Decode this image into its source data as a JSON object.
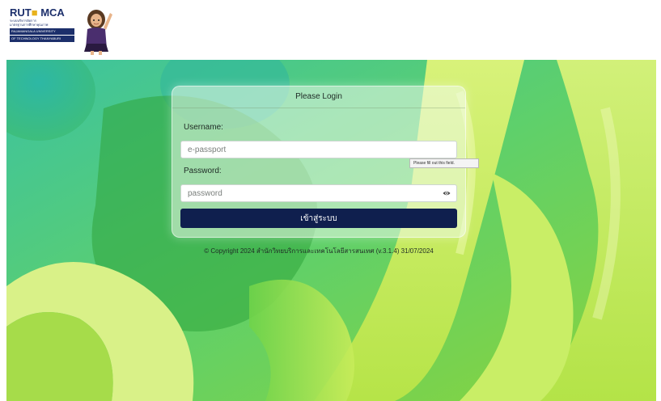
{
  "header": {
    "logo": {
      "title_part1": "RUT",
      "title_accent": "■",
      "title_part2": "MCA",
      "sub_line1": "ระบบบริหารจัดการ",
      "sub_line2": "มาตรฐานการศึกษาคุณภาพ",
      "bar_line1": "RAJAMANGALA UNIVERSITY",
      "bar_line2": "OF TECHNOLOGY THANYABURI",
      "mascot_icon": "mascot-icon"
    }
  },
  "login": {
    "header": "Please Login",
    "username_label": "Username:",
    "username_placeholder": "e-passport",
    "password_label": "Password:",
    "password_placeholder": "password",
    "eye_icon": "eye-icon",
    "submit_label": "เข้าสู่ระบบ",
    "tooltip": "Please fill out this field."
  },
  "footer": {
    "copyright": "© Copyright 2024 สำนักวิทยบริการและเทคโนโลยีสารสนเทศ (v.3.1.4) 31/07/2024"
  },
  "colors": {
    "button_bg": "#0f1f4e",
    "brand_navy": "#1c2f6b",
    "brand_gold": "#e8b21c",
    "background_green": "#9ad63a"
  }
}
